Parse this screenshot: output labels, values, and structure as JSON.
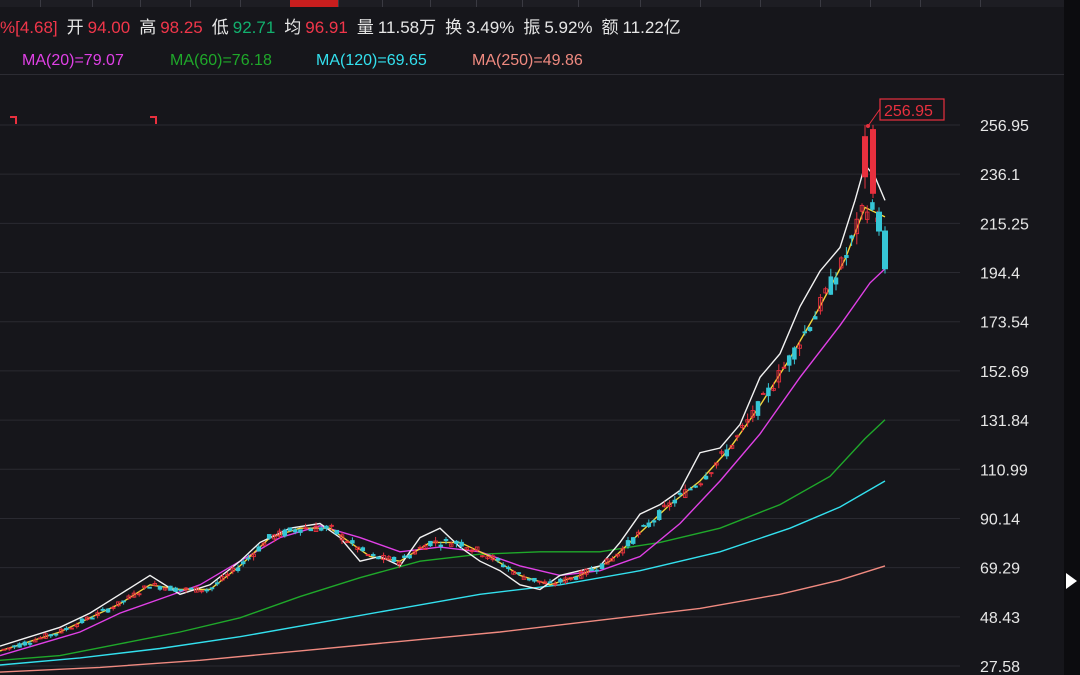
{
  "quote": [
    {
      "label": "",
      "value": "%[4.68]",
      "color": "#f0364a"
    },
    {
      "label": "开",
      "value": "94.00",
      "color": "#f0364a"
    },
    {
      "label": "高",
      "value": "98.25",
      "color": "#f0364a"
    },
    {
      "label": "低",
      "value": "92.71",
      "color": "#12b06e"
    },
    {
      "label": "均",
      "value": "96.91",
      "color": "#f0364a"
    },
    {
      "label": "量",
      "value": "11.58万",
      "color": "#e6e6e6"
    },
    {
      "label": "换",
      "value": "3.49%",
      "color": "#e6e6e6"
    },
    {
      "label": "振",
      "value": "5.92%",
      "color": "#e6e6e6"
    },
    {
      "label": "额",
      "value": "11.22亿",
      "color": "#e6e6e6"
    }
  ],
  "ma_legend": [
    {
      "text": "MA(20)=79.07",
      "color": "#e040e6"
    },
    {
      "text": "MA(60)=76.18",
      "color": "#1fa82a"
    },
    {
      "text": "MA(120)=69.65",
      "color": "#33e0ee"
    },
    {
      "text": "MA(250)=49.86",
      "color": "#f08a80"
    }
  ],
  "chart_data": {
    "type": "line",
    "subtype": "candlestick",
    "y_ticks": [
      "256.95",
      "236.1",
      "215.25",
      "194.4",
      "173.54",
      "152.69",
      "131.84",
      "110.99",
      "90.14",
      "69.29",
      "48.43",
      "27.58"
    ],
    "ylim": [
      27.58,
      256.95
    ],
    "max_marker": "256.95",
    "colors": {
      "up": "#e8303e",
      "down": "#36c6d6",
      "ma5": "#f2f2f2",
      "ma10": "#f5d53a",
      "ma20": "#e040e6",
      "ma60": "#1fa82a",
      "ma120": "#33e0ee",
      "ma250": "#f08a80",
      "grid": "#2a2a31"
    },
    "series": [
      {
        "key": "ma5",
        "points": [
          [
            0,
            36
          ],
          [
            30,
            40
          ],
          [
            60,
            44
          ],
          [
            90,
            50
          ],
          [
            120,
            58
          ],
          [
            150,
            66
          ],
          [
            180,
            58
          ],
          [
            210,
            62
          ],
          [
            240,
            72
          ],
          [
            260,
            80
          ],
          [
            290,
            86
          ],
          [
            320,
            88
          ],
          [
            340,
            82
          ],
          [
            360,
            72
          ],
          [
            380,
            74
          ],
          [
            400,
            70
          ],
          [
            420,
            82
          ],
          [
            440,
            86
          ],
          [
            460,
            78
          ],
          [
            480,
            72
          ],
          [
            500,
            68
          ],
          [
            520,
            62
          ],
          [
            540,
            60
          ],
          [
            560,
            66
          ],
          [
            580,
            68
          ],
          [
            600,
            70
          ],
          [
            620,
            80
          ],
          [
            640,
            92
          ],
          [
            660,
            96
          ],
          [
            680,
            102
          ],
          [
            700,
            118
          ],
          [
            720,
            120
          ],
          [
            740,
            130
          ],
          [
            760,
            150
          ],
          [
            780,
            160
          ],
          [
            800,
            180
          ],
          [
            820,
            195
          ],
          [
            840,
            205
          ],
          [
            855,
            225
          ],
          [
            865,
            240
          ],
          [
            875,
            235
          ],
          [
            885,
            225
          ]
        ]
      },
      {
        "key": "ma10",
        "points": [
          [
            0,
            34
          ],
          [
            30,
            38
          ],
          [
            60,
            42
          ],
          [
            90,
            48
          ],
          [
            120,
            54
          ],
          [
            150,
            62
          ],
          [
            180,
            60
          ],
          [
            210,
            60
          ],
          [
            240,
            70
          ],
          [
            270,
            82
          ],
          [
            300,
            86
          ],
          [
            330,
            86
          ],
          [
            350,
            80
          ],
          [
            370,
            74
          ],
          [
            400,
            72
          ],
          [
            430,
            80
          ],
          [
            460,
            80
          ],
          [
            490,
            74
          ],
          [
            520,
            66
          ],
          [
            550,
            62
          ],
          [
            580,
            66
          ],
          [
            610,
            72
          ],
          [
            640,
            84
          ],
          [
            670,
            96
          ],
          [
            700,
            106
          ],
          [
            730,
            120
          ],
          [
            760,
            138
          ],
          [
            790,
            158
          ],
          [
            820,
            180
          ],
          [
            845,
            200
          ],
          [
            865,
            222
          ],
          [
            885,
            218
          ]
        ]
      },
      {
        "key": "ma20",
        "points": [
          [
            0,
            32
          ],
          [
            40,
            37
          ],
          [
            80,
            42
          ],
          [
            120,
            50
          ],
          [
            160,
            56
          ],
          [
            200,
            62
          ],
          [
            240,
            72
          ],
          [
            280,
            82
          ],
          [
            320,
            87
          ],
          [
            360,
            82
          ],
          [
            400,
            76
          ],
          [
            440,
            78
          ],
          [
            480,
            76
          ],
          [
            520,
            70
          ],
          [
            560,
            66
          ],
          [
            600,
            68
          ],
          [
            640,
            74
          ],
          [
            680,
            88
          ],
          [
            720,
            106
          ],
          [
            760,
            126
          ],
          [
            800,
            150
          ],
          [
            840,
            172
          ],
          [
            870,
            190
          ],
          [
            885,
            196
          ]
        ]
      },
      {
        "key": "ma60",
        "points": [
          [
            0,
            30
          ],
          [
            60,
            32
          ],
          [
            120,
            37
          ],
          [
            180,
            42
          ],
          [
            240,
            48
          ],
          [
            300,
            57
          ],
          [
            360,
            65
          ],
          [
            420,
            72
          ],
          [
            480,
            75
          ],
          [
            540,
            76
          ],
          [
            600,
            76
          ],
          [
            660,
            80
          ],
          [
            720,
            86
          ],
          [
            780,
            96
          ],
          [
            830,
            108
          ],
          [
            865,
            124
          ],
          [
            885,
            132
          ]
        ]
      },
      {
        "key": "ma120",
        "points": [
          [
            0,
            28
          ],
          [
            80,
            31
          ],
          [
            160,
            35
          ],
          [
            240,
            40
          ],
          [
            320,
            46
          ],
          [
            400,
            52
          ],
          [
            480,
            58
          ],
          [
            560,
            62
          ],
          [
            640,
            68
          ],
          [
            720,
            76
          ],
          [
            790,
            86
          ],
          [
            840,
            95
          ],
          [
            885,
            106
          ]
        ]
      },
      {
        "key": "ma250",
        "points": [
          [
            0,
            25
          ],
          [
            100,
            27
          ],
          [
            200,
            30
          ],
          [
            300,
            34
          ],
          [
            400,
            38
          ],
          [
            500,
            42
          ],
          [
            600,
            47
          ],
          [
            700,
            52
          ],
          [
            780,
            58
          ],
          [
            840,
            64
          ],
          [
            885,
            70
          ]
        ]
      }
    ]
  }
}
